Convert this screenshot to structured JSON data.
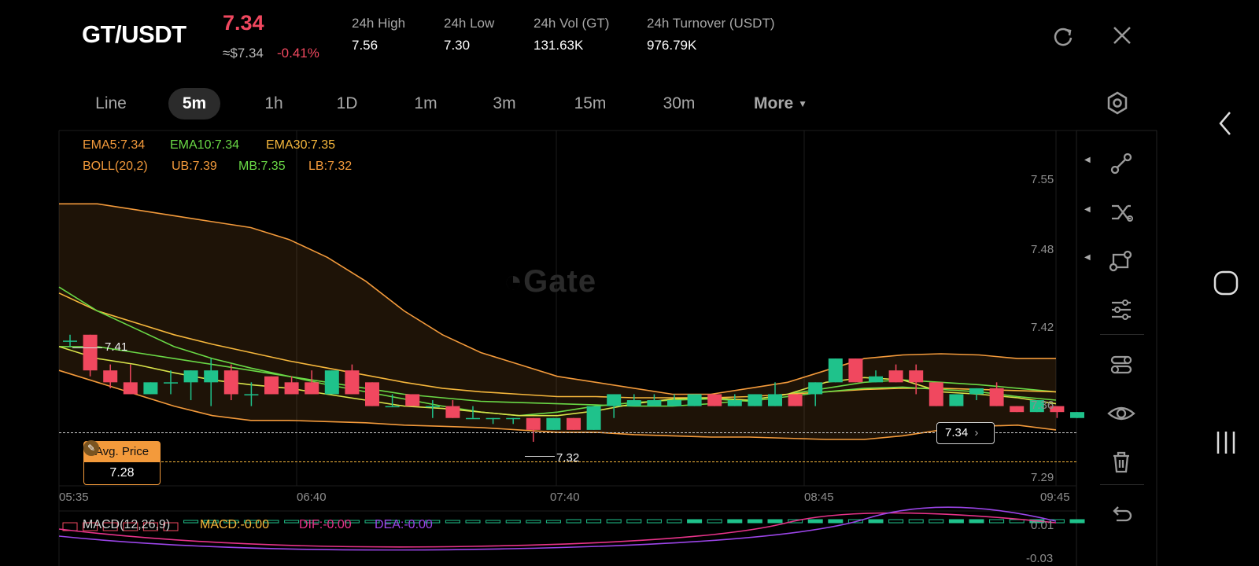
{
  "header": {
    "pair": "GT/USDT",
    "last_price": "7.34",
    "approx_usd": "≈$7.34",
    "change_pct": "-0.41%",
    "stats": [
      {
        "label": "24h   High",
        "value": "7.56"
      },
      {
        "label": "24h   Low",
        "value": "7.30"
      },
      {
        "label": "24h   Vol (GT)",
        "value": "131.63K"
      },
      {
        "label": "24h   Turnover (USDT)",
        "value": "976.79K"
      }
    ]
  },
  "tabs": [
    "Line",
    "5m",
    "1h",
    "1D",
    "1m",
    "3m",
    "15m",
    "30m"
  ],
  "active_tab": "5m",
  "more_label": "More",
  "indicators": {
    "ema5": "EMA5:7.34",
    "ema10": "EMA10:7.34",
    "ema30": "EMA30:7.35",
    "boll": "BOLL(20,2)",
    "ub": "UB:7.39",
    "mb": "MB:7.35",
    "lb": "LB:7.32"
  },
  "markers": {
    "high_label": "7.41",
    "low_label": "7.32",
    "current_price": "7.34",
    "avg_title": "Avg. Price",
    "avg_value": "7.28"
  },
  "macd": {
    "title": "MACD(12,26,9)",
    "macd": "MACD:-0.00",
    "dif": "DIF:-0.00",
    "dea": "DEA:-0.00",
    "ticks": [
      "0.01",
      "-0.03"
    ]
  },
  "watermark": "Gate",
  "colors": {
    "up": "#1fc28b",
    "down": "#f0485f",
    "ema5": "#f39a3b",
    "ema10": "#6ad946",
    "ema30": "#f6b73c",
    "boll": "#f39a3b",
    "dif": "#e8338a",
    "dea": "#9b45e8"
  },
  "chart_data": {
    "type": "candlestick",
    "y_ticks": [
      "7.55",
      "7.48",
      "7.42",
      "7.36",
      "7.29"
    ],
    "x_ticks": [
      "05:35",
      "06:40",
      "07:40",
      "08:45",
      "09:45"
    ],
    "ylim": [
      7.285,
      7.575
    ],
    "candles": [
      {
        "o": 7.405,
        "h": 7.41,
        "l": 7.4,
        "c": 7.405
      },
      {
        "o": 7.41,
        "h": 7.41,
        "l": 7.375,
        "c": 7.38
      },
      {
        "o": 7.38,
        "h": 7.385,
        "l": 7.365,
        "c": 7.37
      },
      {
        "o": 7.37,
        "h": 7.385,
        "l": 7.36,
        "c": 7.36
      },
      {
        "o": 7.36,
        "h": 7.37,
        "l": 7.36,
        "c": 7.37
      },
      {
        "o": 7.37,
        "h": 7.38,
        "l": 7.36,
        "c": 7.37
      },
      {
        "o": 7.37,
        "h": 7.38,
        "l": 7.355,
        "c": 7.38
      },
      {
        "o": 7.37,
        "h": 7.39,
        "l": 7.35,
        "c": 7.38
      },
      {
        "o": 7.38,
        "h": 7.385,
        "l": 7.355,
        "c": 7.36
      },
      {
        "o": 7.36,
        "h": 7.37,
        "l": 7.35,
        "c": 7.36
      },
      {
        "o": 7.375,
        "h": 7.375,
        "l": 7.36,
        "c": 7.36
      },
      {
        "o": 7.37,
        "h": 7.375,
        "l": 7.36,
        "c": 7.36
      },
      {
        "o": 7.37,
        "h": 7.38,
        "l": 7.36,
        "c": 7.36
      },
      {
        "o": 7.36,
        "h": 7.38,
        "l": 7.36,
        "c": 7.38
      },
      {
        "o": 7.38,
        "h": 7.385,
        "l": 7.36,
        "c": 7.36
      },
      {
        "o": 7.37,
        "h": 7.37,
        "l": 7.35,
        "c": 7.35
      },
      {
        "o": 7.35,
        "h": 7.36,
        "l": 7.35,
        "c": 7.35
      },
      {
        "o": 7.36,
        "h": 7.36,
        "l": 7.35,
        "c": 7.35
      },
      {
        "o": 7.35,
        "h": 7.355,
        "l": 7.34,
        "c": 7.35
      },
      {
        "o": 7.35,
        "h": 7.355,
        "l": 7.34,
        "c": 7.34
      },
      {
        "o": 7.34,
        "h": 7.35,
        "l": 7.34,
        "c": 7.34
      },
      {
        "o": 7.34,
        "h": 7.34,
        "l": 7.335,
        "c": 7.34
      },
      {
        "o": 7.34,
        "h": 7.34,
        "l": 7.335,
        "c": 7.34
      },
      {
        "o": 7.34,
        "h": 7.34,
        "l": 7.32,
        "c": 7.33
      },
      {
        "o": 7.33,
        "h": 7.34,
        "l": 7.33,
        "c": 7.34
      },
      {
        "o": 7.34,
        "h": 7.34,
        "l": 7.33,
        "c": 7.33
      },
      {
        "o": 7.33,
        "h": 7.35,
        "l": 7.33,
        "c": 7.35
      },
      {
        "o": 7.35,
        "h": 7.36,
        "l": 7.34,
        "c": 7.36
      },
      {
        "o": 7.35,
        "h": 7.36,
        "l": 7.35,
        "c": 7.355
      },
      {
        "o": 7.35,
        "h": 7.36,
        "l": 7.35,
        "c": 7.355
      },
      {
        "o": 7.35,
        "h": 7.36,
        "l": 7.35,
        "c": 7.355
      },
      {
        "o": 7.35,
        "h": 7.36,
        "l": 7.35,
        "c": 7.36
      },
      {
        "o": 7.36,
        "h": 7.36,
        "l": 7.35,
        "c": 7.35
      },
      {
        "o": 7.35,
        "h": 7.36,
        "l": 7.35,
        "c": 7.355
      },
      {
        "o": 7.35,
        "h": 7.36,
        "l": 7.35,
        "c": 7.36
      },
      {
        "o": 7.35,
        "h": 7.37,
        "l": 7.35,
        "c": 7.36
      },
      {
        "o": 7.36,
        "h": 7.36,
        "l": 7.35,
        "c": 7.35
      },
      {
        "o": 7.36,
        "h": 7.37,
        "l": 7.35,
        "c": 7.37
      },
      {
        "o": 7.37,
        "h": 7.39,
        "l": 7.37,
        "c": 7.39
      },
      {
        "o": 7.39,
        "h": 7.39,
        "l": 7.37,
        "c": 7.37
      },
      {
        "o": 7.37,
        "h": 7.38,
        "l": 7.37,
        "c": 7.375
      },
      {
        "o": 7.38,
        "h": 7.385,
        "l": 7.37,
        "c": 7.37
      },
      {
        "o": 7.38,
        "h": 7.385,
        "l": 7.36,
        "c": 7.37
      },
      {
        "o": 7.37,
        "h": 7.37,
        "l": 7.35,
        "c": 7.35
      },
      {
        "o": 7.35,
        "h": 7.36,
        "l": 7.35,
        "c": 7.36
      },
      {
        "o": 7.36,
        "h": 7.365,
        "l": 7.355,
        "c": 7.365
      },
      {
        "o": 7.365,
        "h": 7.37,
        "l": 7.35,
        "c": 7.35
      },
      {
        "o": 7.35,
        "h": 7.35,
        "l": 7.345,
        "c": 7.345
      },
      {
        "o": 7.345,
        "h": 7.35,
        "l": 7.345,
        "c": 7.355
      },
      {
        "o": 7.35,
        "h": 7.35,
        "l": 7.34,
        "c": 7.345
      },
      {
        "o": 7.34,
        "h": 7.345,
        "l": 7.34,
        "c": 7.345
      }
    ],
    "bollinger_ub": [
      7.52,
      7.52,
      7.515,
      7.51,
      7.505,
      7.5,
      7.49,
      7.475,
      7.455,
      7.43,
      7.41,
      7.395,
      7.385,
      7.375,
      7.37,
      7.365,
      7.36,
      7.36,
      7.365,
      7.37,
      7.38,
      7.39,
      7.393,
      7.394,
      7.393,
      7.39,
      7.39
    ],
    "bollinger_mb": [
      7.4,
      7.4,
      7.395,
      7.39,
      7.385,
      7.38,
      7.375,
      7.37,
      7.365,
      7.36,
      7.357,
      7.354,
      7.353,
      7.352,
      7.351,
      7.35,
      7.35,
      7.352,
      7.355,
      7.36,
      7.365,
      7.37,
      7.372,
      7.37,
      7.368,
      7.365,
      7.362
    ],
    "bollinger_lb": [
      7.38,
      7.37,
      7.36,
      7.35,
      7.342,
      7.338,
      7.338,
      7.337,
      7.336,
      7.334,
      7.333,
      7.332,
      7.33,
      7.328,
      7.328,
      7.326,
      7.325,
      7.324,
      7.324,
      7.323,
      7.322,
      7.322,
      7.325,
      7.33,
      7.333,
      7.334,
      7.33
    ],
    "ema5": [
      7.4,
      7.39,
      7.385,
      7.378,
      7.372,
      7.368,
      7.365,
      7.36,
      7.355,
      7.35,
      7.348,
      7.345,
      7.342,
      7.342,
      7.346,
      7.352,
      7.356,
      7.357,
      7.355,
      7.36,
      7.37,
      7.374,
      7.372,
      7.362,
      7.36,
      7.357,
      7.352
    ],
    "ema10": [
      7.45,
      7.43,
      7.415,
      7.4,
      7.39,
      7.382,
      7.375,
      7.368,
      7.362,
      7.356,
      7.35,
      7.345,
      7.342,
      7.345,
      7.35,
      7.353,
      7.355,
      7.356,
      7.354,
      7.358,
      7.362,
      7.365,
      7.366,
      7.364,
      7.362,
      7.358,
      7.355
    ],
    "ema30": [
      7.445,
      7.43,
      7.42,
      7.41,
      7.402,
      7.395,
      7.388,
      7.382,
      7.376,
      7.37,
      7.365,
      7.362,
      7.36,
      7.358,
      7.358,
      7.357,
      7.357,
      7.357,
      7.358,
      7.36,
      7.362,
      7.364,
      7.365,
      7.365,
      7.364,
      7.363,
      7.362
    ]
  }
}
